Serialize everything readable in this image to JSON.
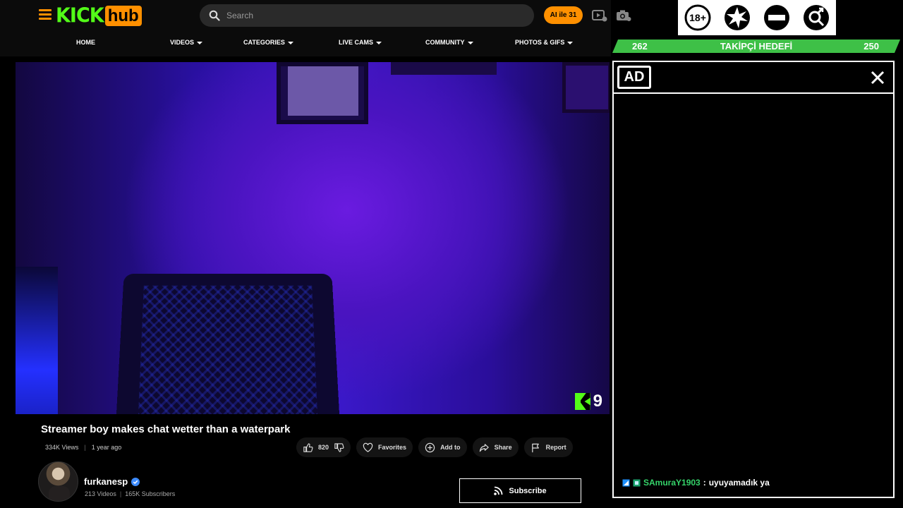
{
  "header": {
    "logo_kick": "KICK",
    "logo_hub": "hub",
    "search_placeholder": "Search",
    "ai_button": "AI ile 31"
  },
  "nav": {
    "items": [
      {
        "label": "HOME",
        "has_caret": false
      },
      {
        "label": "VIDEOS",
        "has_caret": true
      },
      {
        "label": "CATEGORIES",
        "has_caret": true
      },
      {
        "label": "LIVE CAMS",
        "has_caret": true
      },
      {
        "label": "COMMUNITY",
        "has_caret": true
      },
      {
        "label": "PHOTOS & GIFS",
        "has_caret": true
      }
    ]
  },
  "badges": {
    "age": "18+",
    "icons": [
      "age-18-icon",
      "burst-icon",
      "no-entry-icon",
      "gender-icon"
    ]
  },
  "goal": {
    "current": "262",
    "label": "TAKİPÇİ HEDEFİ",
    "target": "250",
    "color": "#3ec047"
  },
  "video": {
    "watermark_number": "9",
    "title": "Streamer boy makes chat wetter than a waterpark",
    "views": "334K Views",
    "age": "1 year ago",
    "likes": "820"
  },
  "actions": {
    "favorites": "Favorites",
    "add_to": "Add to",
    "share": "Share",
    "report": "Report"
  },
  "channel": {
    "name": "furkanesp",
    "videos": "213 Videos",
    "subscribers": "165K Subscribers",
    "subscribe_label": "Subscribe"
  },
  "ad_panel": {
    "label": "AD",
    "chat": {
      "user": "SAmuraY1903",
      "separator": ":",
      "message": "uyuyamadık ya"
    }
  },
  "colors": {
    "accent": "#ff9000",
    "brand_green": "#53fc18",
    "chat_user": "#35d46a"
  }
}
